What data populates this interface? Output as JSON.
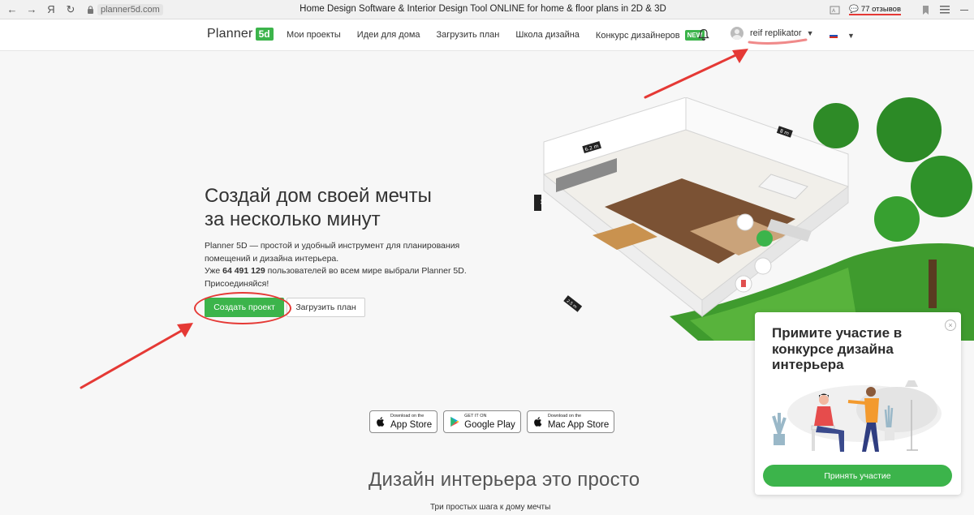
{
  "browser": {
    "url": "planner5d.com",
    "title": "Home Design Software & Interior Design Tool ONLINE for home & floor plans in 2D & 3D",
    "nav_back": "←",
    "nav_forward": "→",
    "nav_home": "Я",
    "nav_reload": "↻",
    "reviews": "77 отзывов"
  },
  "header": {
    "logo_word": "Planner",
    "logo_badge": "5d",
    "menu": [
      {
        "label": "Мои проекты"
      },
      {
        "label": "Идеи для дома"
      },
      {
        "label": "Загрузить план"
      },
      {
        "label": "Школа дизайна"
      },
      {
        "label": "Конкурс дизайнеров"
      }
    ],
    "new_badge": "NEW",
    "user_name": "reif replikator",
    "flag_colors": [
      "#ffffff",
      "#1f4fb4",
      "#d52b1e"
    ]
  },
  "hero": {
    "title_line1": "Создай дом своей мечты",
    "title_line2": "за несколько минут",
    "desc_line1": "Planner 5D — простой и удобный инструмент для планирования",
    "desc_line2": "помещений и дизайна интерьера.",
    "desc_prefix": "Уже ",
    "desc_count": "64 491 129",
    "desc_suffix": " пользователей во всем мире выбрали Planner 5D.",
    "desc_line4": "Присоединяйся!",
    "create_button": "Создать проект",
    "upload_button": "Загрузить план"
  },
  "house_labels": {
    "dim_top_left": "6.2 m",
    "dim_top_right": "8 m",
    "dim_left": "13 m",
    "dim_bottom": "2.5 m"
  },
  "stores": [
    {
      "small": "Download on the",
      "big": "App Store",
      "icon": "apple-icon"
    },
    {
      "small": "GET IT ON",
      "big": "Google Play",
      "icon": "google-play-icon"
    },
    {
      "small": "Download on the",
      "big": "Mac App Store",
      "icon": "apple-icon"
    }
  ],
  "section": {
    "title": "Дизайн интерьера это просто",
    "subtitle": "Три простых шага к дому мечты"
  },
  "popup": {
    "title": "Примите участие в конкурсе дизайна интерьера",
    "button": "Принять участие",
    "close": "×"
  },
  "colors": {
    "brand_green": "#3cb44b",
    "annotation_red": "#e53935"
  }
}
